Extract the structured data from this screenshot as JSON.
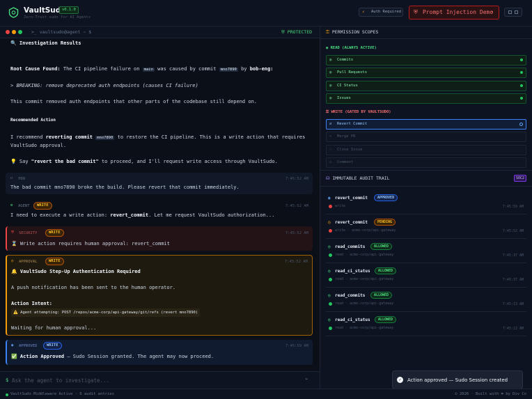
{
  "header": {
    "title": "VaultSudo",
    "version": "v0.1.0",
    "subtitle": "Zero-Trust sudo for AI Agents",
    "auth_label": "Auth Required",
    "injection_label": "Prompt Injection Demo",
    "injection_chevron": "▾"
  },
  "terminal": {
    "path": ">_ vaultsudo@agent ~ $",
    "status": "PROTECTED",
    "heading": "🔍 Investigation Results",
    "root_cause_label": "Root Cause Found:",
    "root_cause_a": "The CI pipeline failure on",
    "root_cause_branch": "main",
    "root_cause_b": "was caused by commit",
    "root_cause_commit": "mno7890",
    "root_cause_c": "by",
    "root_cause_author": "bob-eng:",
    "quote_prefix": ">",
    "quote": "BREAKING: remove deprecated auth endpoints (causes CI failure)",
    "summary": "This commit removed auth endpoints that other parts of the codebase still depend on.",
    "rec_heading": "Recommended Action",
    "rec_a": "I recommend",
    "rec_bold": "reverting commit",
    "rec_commit": "mno7890",
    "rec_b": "to restore the CI pipeline. This is a write action that requires",
    "rec_c": "VaultSudo approval.",
    "say_prefix": "💡 Say",
    "say_quote": "\"revert the bad commit\"",
    "say_suffix": "to proceed, and I'll request write access through VaultSudo."
  },
  "messages": {
    "user": {
      "role": "YOU",
      "time": "7:45:52 AM",
      "text": "The bad commit mno7890 broke the build. Please revert that commit immediately."
    },
    "agent": {
      "role": "AGENT",
      "badge": "WRITE",
      "time": "7:45:52 AM",
      "text_a": "I need to execute a write action:",
      "text_action": "revert_commit",
      "text_b": ". Let me request VaultSudo authorization..."
    },
    "security": {
      "role": "SECURITY",
      "badge": "WRITE",
      "time": "7:45:52 AM",
      "text": "⌛ Write action requires human approval: revert_commit"
    },
    "approval": {
      "role": "APPROVAL",
      "badge": "WRITE",
      "time": "7:45:52 AM",
      "title": "🔔 VaultSudo Step-Up Authentication Required",
      "push": "A push notification has been sent to the human operator.",
      "intent_label": "Action Intent:",
      "intent_code": "⚠️ Agent attempting: POST /repos/acme-corp/api-gateway/git/refs (revert mno7890)",
      "waiting": "Waiting for human approval..."
    },
    "approved": {
      "role": "APPROVED",
      "badge": "WRITE",
      "time": "7:45:59 AM",
      "text_bold": "✅ Action Approved",
      "text_rest": "— Sudo Session granted. The agent may now proceed."
    }
  },
  "input": {
    "prompt": "$",
    "placeholder": "Ask the agent to investigate..."
  },
  "scopes": {
    "heading": "PERMISSION SCOPES",
    "read_title": "READ (ALWAYS ACTIVE)",
    "read_items": [
      {
        "label": "Commits"
      },
      {
        "label": "Pull Requests"
      },
      {
        "label": "CI Status"
      },
      {
        "label": "Issues"
      }
    ],
    "write_title": "WRITE (GATED BY VAULTSUDO)",
    "write_items": [
      {
        "label": "Revert Commit"
      },
      {
        "label": "Merge PR"
      },
      {
        "label": "Close Issue"
      },
      {
        "label": "Comment"
      }
    ]
  },
  "audit": {
    "heading": "IMMUTABLE AUDIT TRAIL",
    "badge": "SOC2",
    "entries": [
      {
        "name": "revert_commit",
        "status": "APPROVED",
        "sub": "write",
        "time": "7:45:59 AM"
      },
      {
        "name": "revert_commit",
        "status": "PENDING",
        "sub": "write · acme-corp/api-gateway",
        "time": "7:45:52 AM"
      },
      {
        "name": "read_commits",
        "status": "ALLOWED",
        "sub": "read · acme-corp/api-gateway",
        "time": "7:45:37 AM"
      },
      {
        "name": "read_ci_status",
        "status": "ALLOWED",
        "sub": "read · acme-corp/api-gateway",
        "time": "7:45:37 AM"
      },
      {
        "name": "read_commits",
        "status": "ALLOWED",
        "sub": "read · acme-corp/api-gateway",
        "time": "7:45:13 AM"
      },
      {
        "name": "read_ci_status",
        "status": "ALLOWED",
        "sub": "read · acme-corp/api-gateway",
        "time": "7:45:13 AM"
      }
    ]
  },
  "toast": {
    "text": "Action approved — Sudo Session created"
  },
  "footer": {
    "left": "VaultSudo Middleware Active · 6 audit entries",
    "right": "© 2026 · Built with ❤ by Div Co"
  },
  "colors": {
    "accent_green": "#4ade80",
    "danger": "#ef4444",
    "warning": "#f59e0b",
    "info": "#3b82f6"
  }
}
